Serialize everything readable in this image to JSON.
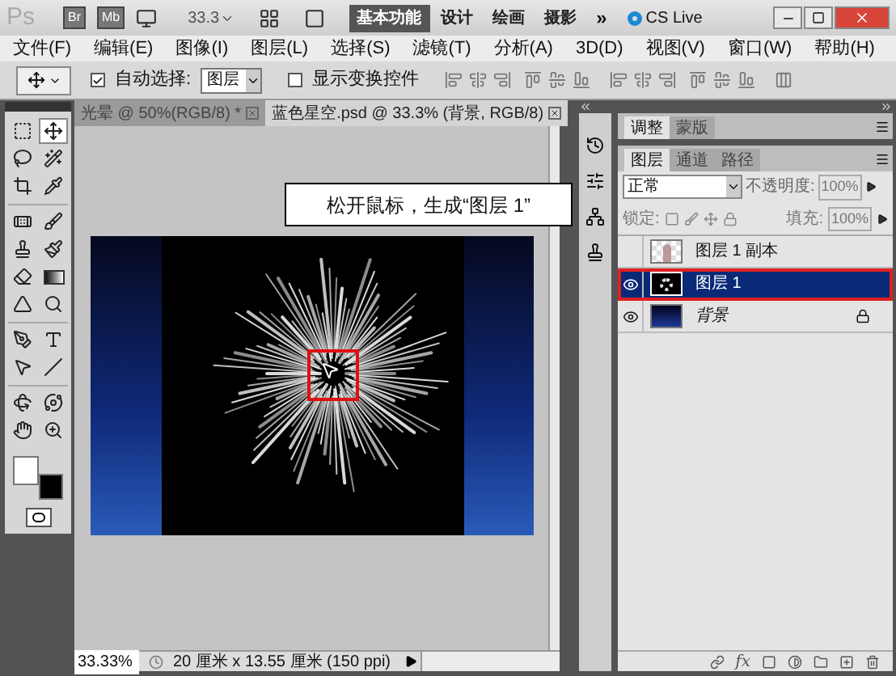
{
  "app_bar": {
    "logo": "Ps",
    "bridge": "Br",
    "mini_bridge": "Mb",
    "zoom": "33.3",
    "workspaces": [
      {
        "label": "基本功能",
        "selected": true
      },
      {
        "label": "设计",
        "selected": false
      },
      {
        "label": "绘画",
        "selected": false
      },
      {
        "label": "摄影",
        "selected": false
      }
    ],
    "more": "»",
    "cs_live": "CS Live"
  },
  "menu": [
    "文件(F)",
    "编辑(E)",
    "图像(I)",
    "图层(L)",
    "选择(S)",
    "滤镜(T)",
    "分析(A)",
    "3D(D)",
    "视图(V)",
    "窗口(W)",
    "帮助(H)"
  ],
  "options_bar": {
    "auto_select": {
      "label": "自动选择:",
      "checked": true,
      "value": "图层"
    },
    "show_transform": {
      "label": "显示变换控件",
      "checked": false
    }
  },
  "tool_groups": [
    [
      {
        "kind": "marquee",
        "selected": false
      },
      {
        "kind": "move",
        "selected": true
      },
      {
        "kind": "lasso",
        "selected": false
      },
      {
        "kind": "wand",
        "selected": false
      },
      {
        "kind": "crop",
        "selected": false
      },
      {
        "kind": "eyedropper",
        "selected": false
      }
    ],
    [
      {
        "kind": "healing",
        "selected": false
      },
      {
        "kind": "brush",
        "selected": false
      },
      {
        "kind": "stamp",
        "selected": false
      },
      {
        "kind": "history",
        "selected": false
      },
      {
        "kind": "eraser",
        "selected": false
      },
      {
        "kind": "gradient",
        "selected": false
      },
      {
        "kind": "blur",
        "selected": false
      },
      {
        "kind": "dodge",
        "selected": false
      }
    ],
    [
      {
        "kind": "pen",
        "selected": false
      },
      {
        "kind": "type",
        "selected": false
      },
      {
        "kind": "path",
        "selected": false
      },
      {
        "kind": "line",
        "selected": false
      }
    ],
    [
      {
        "kind": "rotate3d",
        "selected": false
      },
      {
        "kind": "orbit3d",
        "selected": false
      },
      {
        "kind": "hand",
        "selected": false
      },
      {
        "kind": "zoom",
        "selected": false
      }
    ]
  ],
  "document_tabs": [
    {
      "label": "光晕 @ 50%(RGB/8) *",
      "selected": false
    },
    {
      "label": "蓝色星空.psd @ 33.3% (背景, RGB/8)",
      "selected": true
    }
  ],
  "callout": "松开鼠标，生成“图层 1”",
  "status_bar": {
    "zoom": "33.33%",
    "doc_info": "20 厘米 x 13.55 厘米 (150 ppi)"
  },
  "panels": {
    "top_tabs": [
      {
        "label": "调整",
        "selected": true
      },
      {
        "label": "蒙版",
        "selected": false
      }
    ],
    "layer_tabs": [
      {
        "label": "图层",
        "selected": true
      },
      {
        "label": "通道",
        "selected": false
      },
      {
        "label": "路径",
        "selected": false
      }
    ],
    "blend_mode": "正常",
    "opacity_label": "不透明度:",
    "opacity": "100%",
    "lock_label": "锁定:",
    "fill_label": "填充:",
    "fill": "100%",
    "layers": [
      {
        "name": "图层 1 副本",
        "kind": "figure",
        "visible": false,
        "selected": false,
        "locked": false
      },
      {
        "name": "图层 1",
        "kind": "firework",
        "visible": true,
        "selected": true,
        "locked": false
      },
      {
        "name": "背景",
        "kind": "sky",
        "visible": true,
        "selected": false,
        "locked": true
      }
    ],
    "fx": "fx"
  }
}
